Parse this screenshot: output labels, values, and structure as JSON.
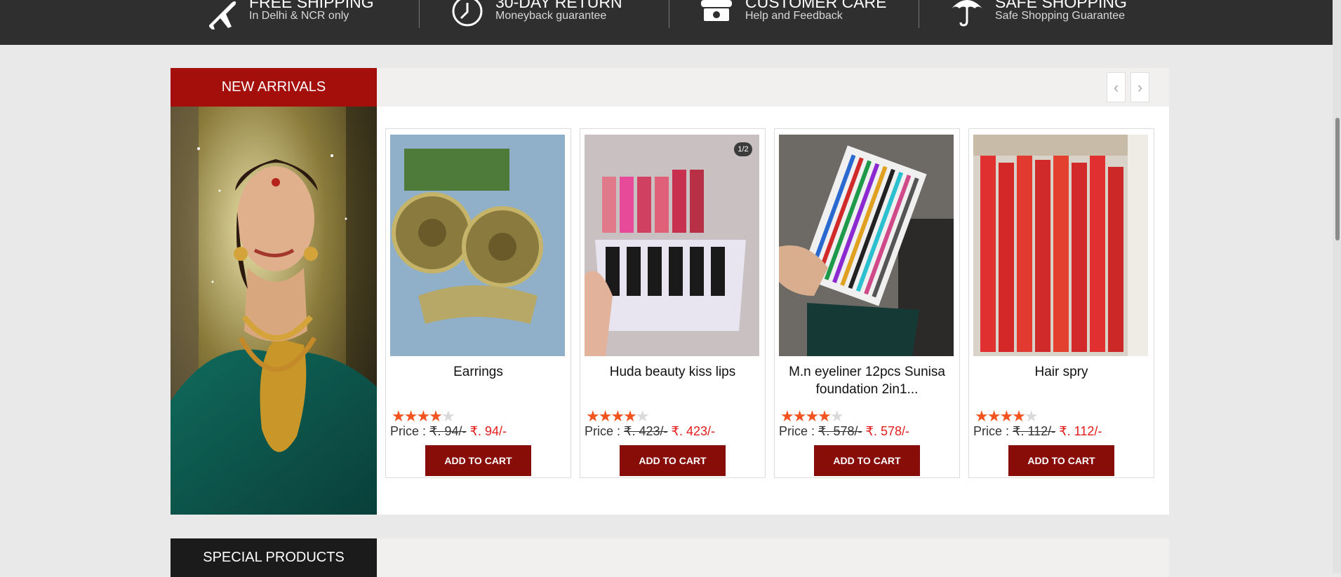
{
  "features": [
    {
      "icon": "airplane-icon",
      "title": "FREE SHIPPING",
      "subtitle": "In Delhi & NCR only"
    },
    {
      "icon": "clock-icon",
      "title": "30-DAY RETURN",
      "subtitle": "Moneyback guarantee"
    },
    {
      "icon": "phone-icon",
      "title": "CUSTOMER CARE",
      "subtitle": "Help and Feedback"
    },
    {
      "icon": "umbrella-icon",
      "title": "SAFE SHOPPING",
      "subtitle": "Safe Shopping Guarantee"
    }
  ],
  "new_arrivals": {
    "title": "NEW ARRIVALS",
    "prev_icon": "chevron-left-icon",
    "next_icon": "chevron-right-icon",
    "products": [
      {
        "name": "Earrings",
        "rating": 4,
        "price_label": "Price :",
        "old_price": "₹. 94/-",
        "new_price": "₹. 94/-",
        "cart_label": "ADD TO CART"
      },
      {
        "name": "Huda beauty kiss lips",
        "rating": 4,
        "price_label": "Price :",
        "old_price": "₹. 423/-",
        "new_price": "₹. 423/-",
        "cart_label": "ADD TO CART",
        "badge": "1/2"
      },
      {
        "name": "M.n eyeliner 12pcs Sunisa foundation 2in1...",
        "rating": 4,
        "price_label": "Price :",
        "old_price": "₹. 578/-",
        "new_price": "₹. 578/-",
        "cart_label": "ADD TO CART"
      },
      {
        "name": "Hair spry",
        "rating": 4,
        "price_label": "Price :",
        "old_price": "₹. 112/-",
        "new_price": "₹. 112/-",
        "cart_label": "ADD TO CART"
      }
    ]
  },
  "special_products": {
    "title": "SPECIAL PRODUCTS"
  },
  "colors": {
    "topbar": "#2f2f2f",
    "accent_red": "#a50f0b",
    "cart_button": "#880d09",
    "sale_price": "#e21b1b",
    "star": "#f2531f"
  }
}
